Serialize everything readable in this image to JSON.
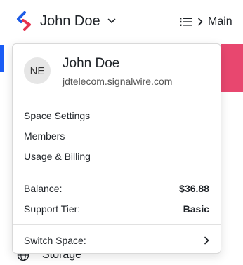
{
  "header": {
    "space_name": "John Doe",
    "breadcrumb_label": "Main"
  },
  "sidebar": {
    "items": [
      {
        "label": "Storage",
        "icon": "globe-icon"
      }
    ]
  },
  "account_menu": {
    "avatar_initials": "NE",
    "user_name": "John Doe",
    "user_domain": "jdtelecom.signalwire.com",
    "links": [
      {
        "label": "Space Settings"
      },
      {
        "label": "Members"
      },
      {
        "label": "Usage & Billing"
      }
    ],
    "balance": {
      "label": "Balance:",
      "value": "$36.88"
    },
    "support_tier": {
      "label": "Support Tier:",
      "value": "Basic"
    },
    "switch_space": {
      "label": "Switch Space:"
    }
  },
  "colors": {
    "accent": "#1a5cf5",
    "brand_red": "#e8476f",
    "logo_blue": "#1d5ce6",
    "logo_red": "#e5324f"
  }
}
